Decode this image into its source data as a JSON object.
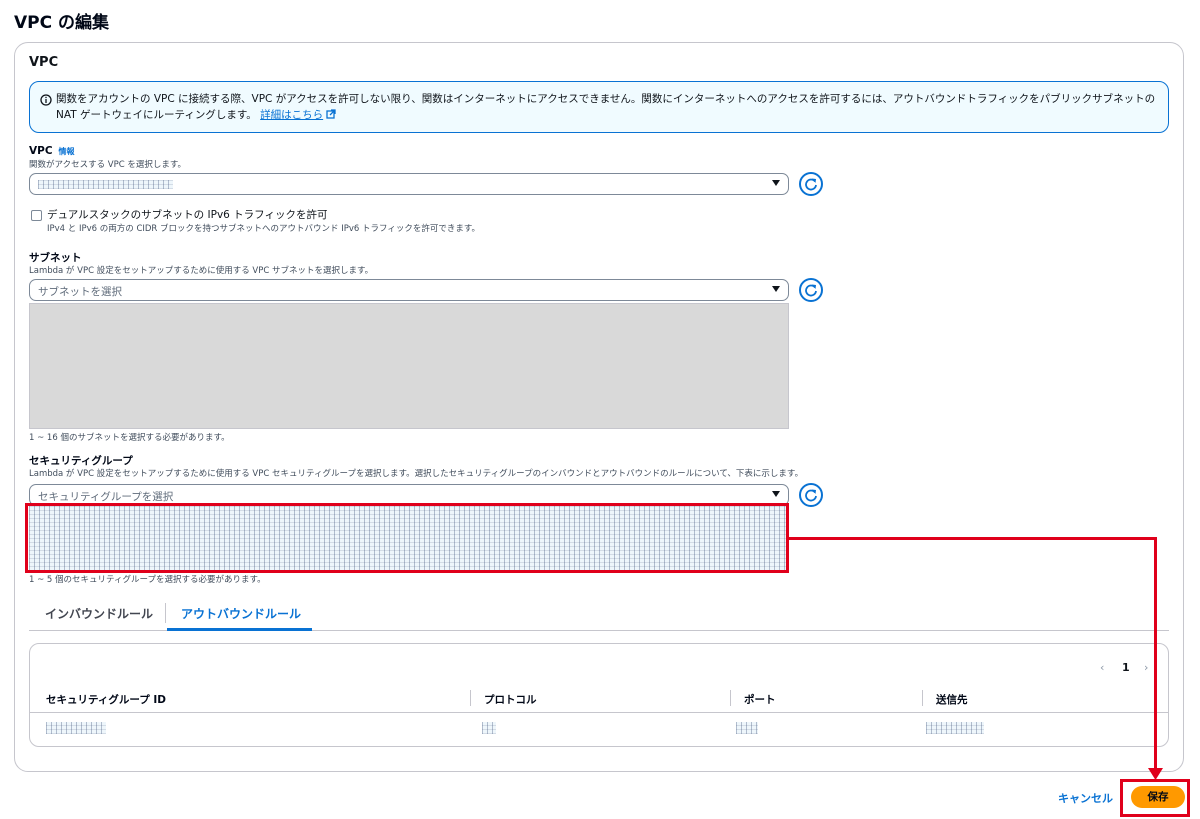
{
  "page": {
    "title": "VPC の編集"
  },
  "container": {
    "header": "VPC"
  },
  "alert": {
    "text": "関数をアカウントの VPC に接続する際、VPC がアクセスを許可しない限り、関数はインターネットにアクセスできません。関数にインターネットへのアクセスを許可するには、アウトバウンドトラフィックをパブリックサブネットの NAT ゲートウェイにルーティングします。",
    "link": "詳細はこちら",
    "icon": "info-icon",
    "color": "#0972d3"
  },
  "vpc": {
    "label": "VPC",
    "info": "情報",
    "description": "関数がアクセスする VPC を選択します。"
  },
  "ipv6": {
    "label": "デュアルスタックのサブネットの IPv6 トラフィックを許可",
    "description": "IPv4 と IPv6 の両方の CIDR ブロックを持つサブネットへのアウトバウンド IPv6 トラフィックを許可できます。",
    "checked": false
  },
  "subnet": {
    "label": "サブネット",
    "description": "Lambda が VPC 設定をセットアップするために使用する VPC サブネットを選択します。",
    "placeholder": "サブネットを選択",
    "constraint": "1 ~ 16 個のサブネットを選択する必要があります。"
  },
  "security_group": {
    "label": "セキュリティグループ",
    "description": "Lambda が VPC 設定をセットアップするために使用する VPC セキュリティグループを選択します。選択したセキュリティグループのインバウンドとアウトバウンドのルールについて、下表に示します。",
    "placeholder": "セキュリティグループを選択",
    "constraint": "1 ~ 5 個のセキュリティグループを選択する必要があります。"
  },
  "tabs": [
    {
      "label": "インバウンドルール",
      "active": false
    },
    {
      "label": "アウトバウンドルール",
      "active": true
    }
  ],
  "rules_table": {
    "page": "1",
    "columns": [
      "セキュリティグループ ID",
      "プロトコル",
      "ポート",
      "送信先"
    ]
  },
  "footer": {
    "cancel": "キャンセル",
    "save": "保存"
  },
  "colors": {
    "primary": "#ff9900",
    "link": "#0972d3",
    "highlight": "#e0001b"
  }
}
